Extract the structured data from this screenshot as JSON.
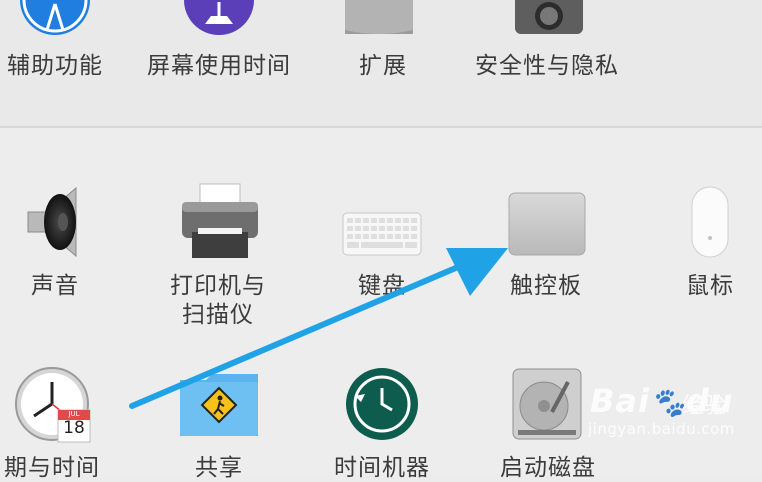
{
  "top_row": [
    {
      "name": "accessibility",
      "label": "辅助功能"
    },
    {
      "name": "screen-time",
      "label": "屏幕使用时间"
    },
    {
      "name": "extensions",
      "label": "扩展"
    },
    {
      "name": "security-privacy",
      "label": "安全性与隐私"
    }
  ],
  "middle_row": [
    {
      "name": "sound",
      "label": "声音"
    },
    {
      "name": "printers-scanners",
      "label_line1": "打印机与",
      "label_line2": "扫描仪"
    },
    {
      "name": "keyboard",
      "label": "键盘"
    },
    {
      "name": "trackpad",
      "label": "触控板"
    },
    {
      "name": "mouse",
      "label": "鼠标"
    }
  ],
  "bottom_row": [
    {
      "name": "date-time",
      "label": "日期与时间",
      "calendar_month": "JUL",
      "calendar_day": "18"
    },
    {
      "name": "sharing",
      "label": "共享"
    },
    {
      "name": "time-machine",
      "label": "时间机器"
    },
    {
      "name": "startup-disk",
      "label": "启动磁盘"
    }
  ],
  "annotation": {
    "arrow_color": "#1fa3e6"
  },
  "watermark": {
    "brand": "Bai",
    "brand_suffix": "du",
    "jingyan": "经验",
    "url": "jingyan.baidu.com"
  }
}
